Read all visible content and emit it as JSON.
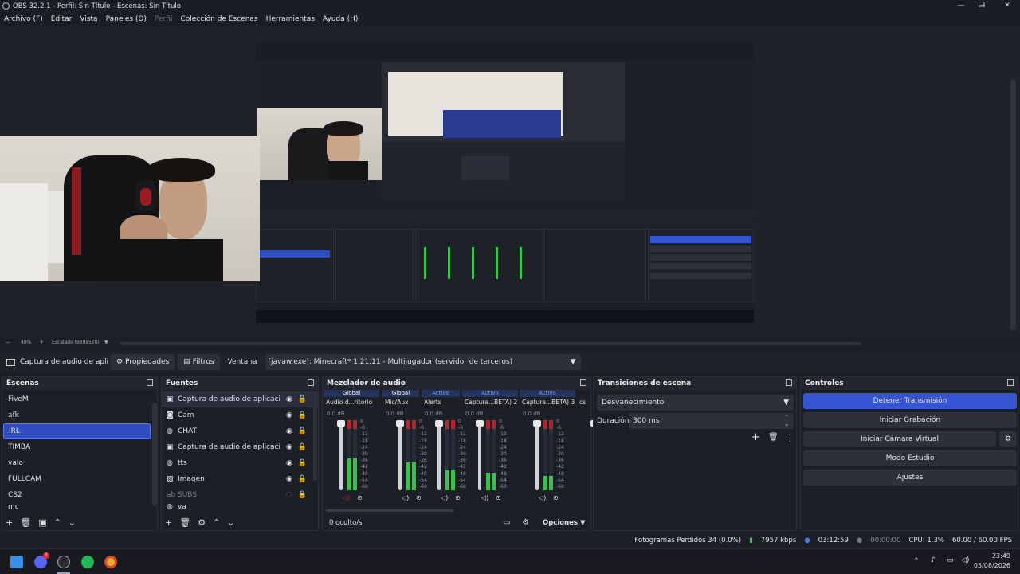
{
  "window": {
    "title": "OBS 32.2.1 - Perfil: Sin Título - Escenas: Sin Título",
    "minimize": "—",
    "maximize": "❐",
    "close": "✕"
  },
  "menu": [
    "Archivo (F)",
    "Editar",
    "Vista",
    "Paneles (D)",
    "Perfil",
    "Colección de Escenas",
    "Herramientas",
    "Ayuda (H)"
  ],
  "viewbar": {
    "zoom": "48%",
    "scale": "Escalado (939x528)"
  },
  "source_bar": {
    "source_name": "Captura de audio de aplicac",
    "properties": "Propiedades",
    "filters": "Filtros",
    "window_label": "Ventana",
    "window_value": "[javaw.exe]: Minecraft* 1.21.11 - Multijugador (servidor de terceros)"
  },
  "scenes": {
    "title": "Escenas",
    "items": [
      "FiveM",
      "afk",
      "IRL",
      "TIMBA",
      "valo",
      "FULLCAM",
      "CS2",
      "mc"
    ],
    "selected": "IRL"
  },
  "sources": {
    "title": "Fuentes",
    "items": [
      {
        "icon": "window-icon",
        "label": "Captura de audio de aplicación (E"
      },
      {
        "icon": "camera-icon",
        "label": "Cam"
      },
      {
        "icon": "globe-icon",
        "label": "CHAT"
      },
      {
        "icon": "window-icon",
        "label": "Captura de audio de aplicación (E"
      },
      {
        "icon": "globe-icon",
        "label": "tts"
      },
      {
        "icon": "image-icon",
        "label": "Imagen"
      },
      {
        "icon": "text-icon",
        "label": "SUBS"
      },
      {
        "icon": "globe-icon",
        "label": "va"
      }
    ]
  },
  "mixer": {
    "title": "Mezclador de audio",
    "channels": [
      {
        "tag": "Global",
        "name": "Audio d...ritorio",
        "db": "0.0 dB",
        "level": 0.45
      },
      {
        "tag": "Global",
        "name": "Mic/Aux",
        "db": "0.0 dB",
        "level": 0.4
      },
      {
        "tag": "Activo",
        "name": "Alerts",
        "db": "0.0 dB",
        "level": 0.3
      },
      {
        "tag": "Activo",
        "name": "Captura...BETA) 2",
        "db": "0.0 dB",
        "level": 0.25
      },
      {
        "tag": "Activo",
        "name": "Captura...BETA) 3",
        "db": "0.0 dB",
        "level": 0.2
      },
      {
        "tag": "",
        "name": "cs",
        "db": "",
        "level": 0.3
      }
    ],
    "scale": [
      "0",
      "-6",
      "-12",
      "-18",
      "-24",
      "-30",
      "-36",
      "-42",
      "-48",
      "-54",
      "-60"
    ],
    "hidden": "0 oculto/s",
    "options": "Opciones"
  },
  "transitions": {
    "title": "Transiciones de escena",
    "selected": "Desvanecimiento",
    "duration_label": "Duración",
    "duration_value": "300 ms"
  },
  "controls": {
    "title": "Controles",
    "stop_stream": "Detener Transmisión",
    "start_record": "Iniciar Grabación",
    "start_vcam": "Iniciar Cámara Virtual",
    "studio_mode": "Modo Estudio",
    "settings": "Ajustes"
  },
  "status": {
    "dropped": "Fotogramas Perdidos 34 (0.0%)",
    "bitrate": "7957 kbps",
    "stream_time": "03:12:59",
    "record_time": "00:00:00",
    "cpu": "CPU: 1.3%",
    "fps": "60.00 / 60.00 FPS"
  },
  "taskbar": {
    "time": "23:49",
    "date": "05/08/2026",
    "discord_badge": "1"
  },
  "colors": {
    "accent": "#3454d1",
    "bg": "#1d1f26",
    "meter_green": "#3fbf4f",
    "meter_red": "#b3262f"
  }
}
